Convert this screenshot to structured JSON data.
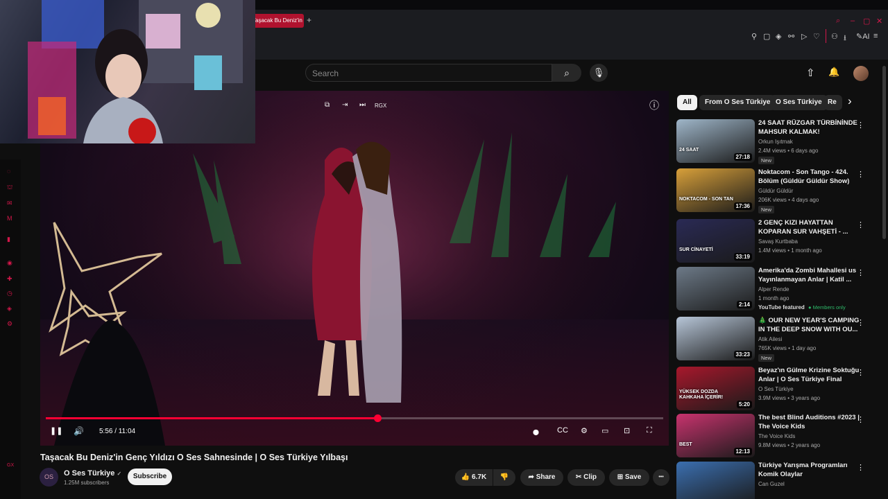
{
  "browser": {
    "tab_title": "Taşacak Bu Deniz'in Genç Yıldızı",
    "new_tab": "+",
    "window_controls": [
      "⌕",
      "–",
      "▢",
      "✕"
    ],
    "extension_icons": [
      "⚲",
      "▢",
      "◈",
      "⚯",
      "▷",
      "♡",
      "⚇",
      "⭳",
      "✎AI",
      "≡"
    ],
    "video_overlay": {
      "icons": [
        "⧉",
        "⇥",
        "⏭"
      ],
      "rgx": "RGX",
      "info": "ⓘ"
    }
  },
  "youtube": {
    "search_placeholder": "Search",
    "search_icon": "⌕",
    "mic_icon": "🎙",
    "upload_icon": "⇧",
    "bell_icon": "🔔"
  },
  "left_rail": {
    "icons": [
      "◌",
      "⛫",
      "✉",
      "M",
      "▮",
      "◉",
      "✚",
      "◷",
      "◈",
      "⚙"
    ],
    "bottom_label": "GX"
  },
  "player": {
    "time": "5:56 / 11:04",
    "progress": 0.537,
    "play_icon": "❚❚",
    "volume_icon": "🔊",
    "right_icons": [
      "⬤",
      "CC",
      "⚙",
      "▭",
      "⊡",
      "⛶"
    ]
  },
  "video": {
    "title": "Taşacak Bu Deniz'in Genç Yıldızı O Ses Sahnesinde | O Ses Türkiye Yılbaşı",
    "channel": {
      "name": "O Ses Türkiye",
      "verified": "✓",
      "subscribers": "1.25M subscribers",
      "avatar_text": "OS"
    },
    "subscribe_label": "Subscribe",
    "actions": {
      "likes": "6.7K",
      "like_icon": "👍",
      "dislike_icon": "👎",
      "share": "Share",
      "share_icon": "➦",
      "clip": "Clip",
      "clip_icon": "✂",
      "save": "Save",
      "save_icon": "⊞",
      "more_icon": "•••"
    }
  },
  "chips": {
    "items": [
      "All",
      "From O Ses Türkiye",
      "O Ses Türkiye",
      "Re"
    ],
    "next_icon": "›"
  },
  "recommendations": [
    {
      "title": "24 SAAT RÜZGAR TÜRBİNİNDE MAHSUR KALMAK!",
      "channel": "Orkun Işıtmak",
      "meta": "2.4M views • 6 days ago",
      "badge": "New",
      "duration": "27:18",
      "thumb_color": "#9fb6c9",
      "thumb_text": "24 SAAT"
    },
    {
      "title": "Noktacom - Son Tango - 424. Bölüm (Güldür Güldür Show)",
      "channel": "Güldür Güldür",
      "meta": "206K views • 4 days ago",
      "badge": "New",
      "duration": "17:36",
      "thumb_color": "#d8a03a",
      "thumb_text": "NOKTACOM - SON TAN"
    },
    {
      "title": "2 GENÇ KIZI HAYATTAN KOPARAN SUR VAHŞETİ - ...",
      "channel": "Savaş Kurtbaba",
      "meta": "1.4M views • 1 month ago",
      "badge": "",
      "duration": "33:19",
      "thumb_color": "#2a2a55",
      "thumb_text": "SUR CİNAYETİ"
    },
    {
      "title": "Amerika'da Zombi Mahallesi us Yayınlanmayan Anlar | Katil ...",
      "channel": "Alper Rende",
      "meta": "1 month ago",
      "badge": "",
      "featured": "YouTube featured",
      "members": "● Members only",
      "duration": "2:14",
      "thumb_color": "#6d7a88",
      "thumb_text": ""
    },
    {
      "title": "🎄 OUR NEW YEAR'S CAMPING IN THE DEEP SNOW WITH OU...",
      "channel": "Atik Ailesi",
      "meta": "765K views • 1 day ago",
      "badge": "New",
      "duration": "33:23",
      "thumb_color": "#b7c6d8",
      "thumb_text": ""
    },
    {
      "title": "Beyaz'ın Gülme Krizine Soktuğu Anlar | O Ses Türkiye Final",
      "channel": "O Ses Türkiye",
      "meta": "3.9M views • 3 years ago",
      "badge": "",
      "duration": "5:20",
      "thumb_color": "#a8182c",
      "thumb_text": "YÜKSEK DOZDA KAHKAHA İÇERİR!"
    },
    {
      "title": "The best Blind Auditions #2023 | The Voice Kids",
      "channel": "The Voice Kids",
      "meta": "9.8M views • 2 years ago",
      "badge": "",
      "duration": "12:13",
      "thumb_color": "#c8336e",
      "thumb_text": "BEST"
    },
    {
      "title": "Türkiye Yarışma Programları Komik Olaylar",
      "channel": "Can Guzel",
      "meta": "",
      "badge": "",
      "duration": "",
      "thumb_color": "#3b6fb0",
      "thumb_text": ""
    }
  ],
  "colors": {
    "accent": "#ff0033",
    "browser_accent": "#d4174a",
    "bg": "#0f0f0f",
    "members": "#2fba6a"
  }
}
